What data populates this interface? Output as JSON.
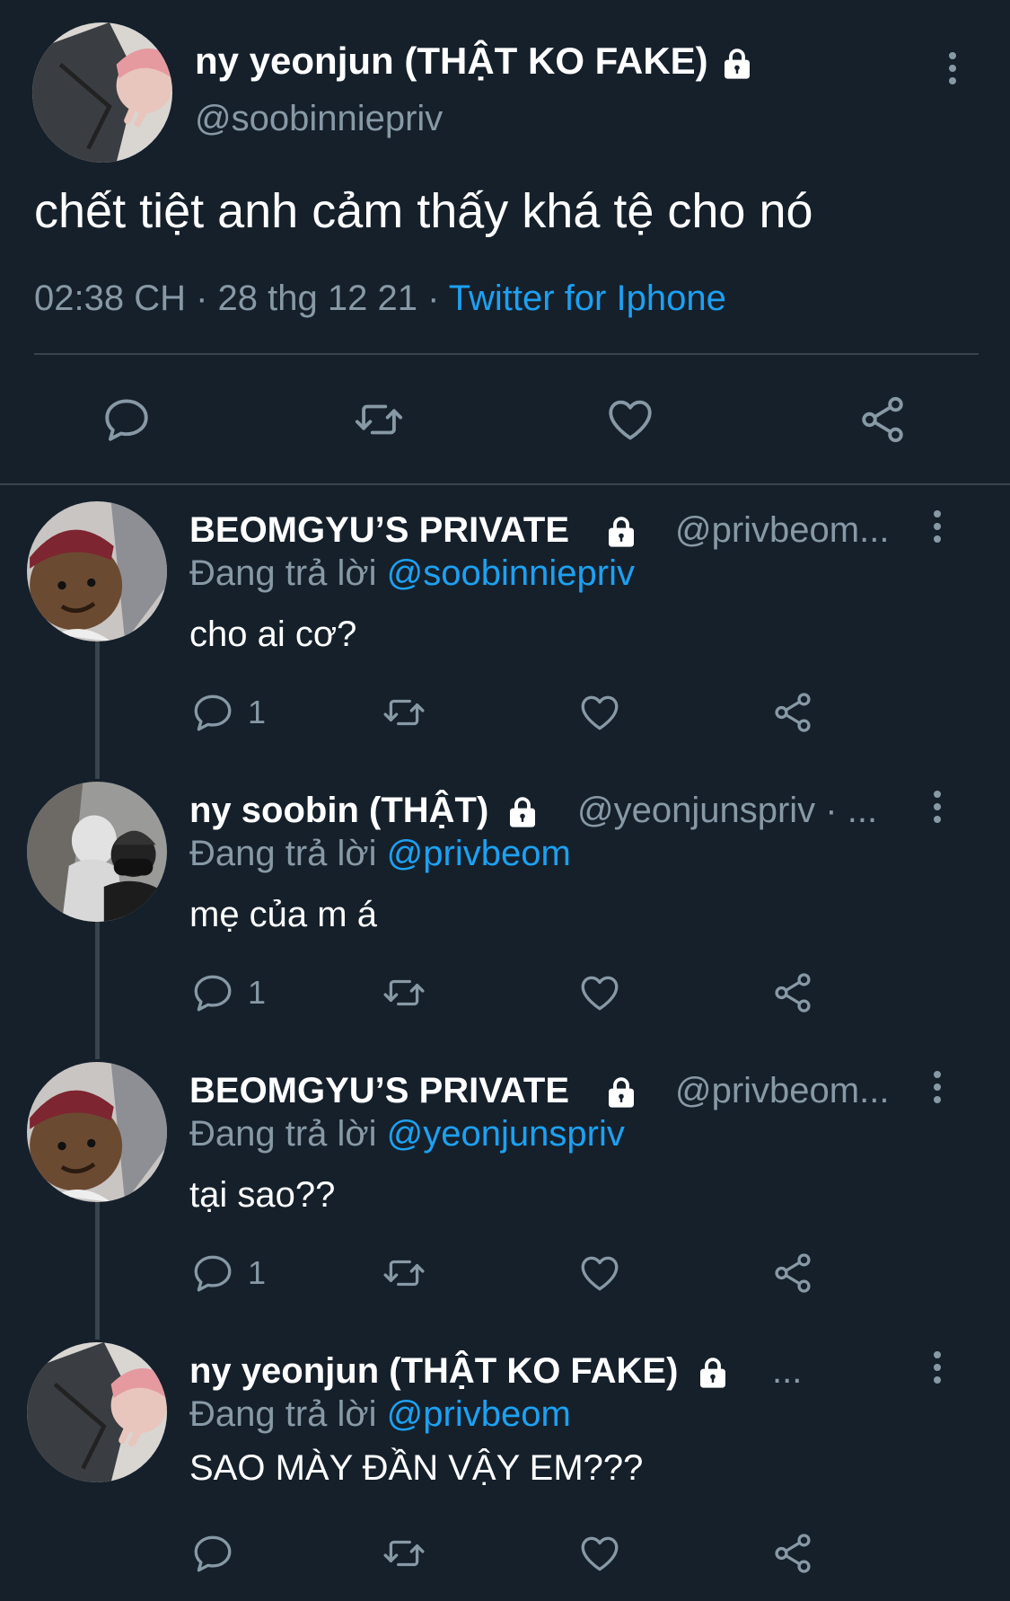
{
  "main_tweet": {
    "author_name": "ny yeonjun (THẬT KO FAKE)",
    "author_handle": "@soobinniepriv",
    "text": "chết tiệt anh cảm thấy khá tệ cho nó",
    "time": "02:38 CH · 28 thg 12 21 · ",
    "source": "Twitter for Iphone",
    "avatar_icon": "avatar-photo"
  },
  "replies": [
    {
      "author_name": "BEOMGYU’S PRIVATE",
      "author_handle": "@privbeom...",
      "replying_label": "Đang trả lời",
      "replying_to": "@soobinniepriv",
      "text": "cho ai cơ?",
      "reply_count": "1"
    },
    {
      "author_name": "ny soobin (THẬT)",
      "author_handle": "@yeonjunspriv · ...",
      "replying_label": "Đang trả lời",
      "replying_to": "@privbeom",
      "text": "mẹ của m á",
      "reply_count": "1"
    },
    {
      "author_name": "BEOMGYU’S PRIVATE",
      "author_handle": "@privbeom...",
      "replying_label": "Đang trả lời",
      "replying_to": "@yeonjunspriv",
      "text": "tại sao??",
      "reply_count": "1"
    },
    {
      "author_name": "ny yeonjun (THẬT KO FAKE)",
      "author_handle": "...",
      "replying_label": "Đang trả lời",
      "replying_to": "@privbeom",
      "text": "SAO MÀY ĐẦN VẬY EM???",
      "reply_count": ""
    }
  ],
  "colors": {
    "background": "#15202b",
    "text": "#ffffff",
    "secondary": "#8899a6",
    "link": "#1da1f2",
    "divider": "#38444d"
  }
}
